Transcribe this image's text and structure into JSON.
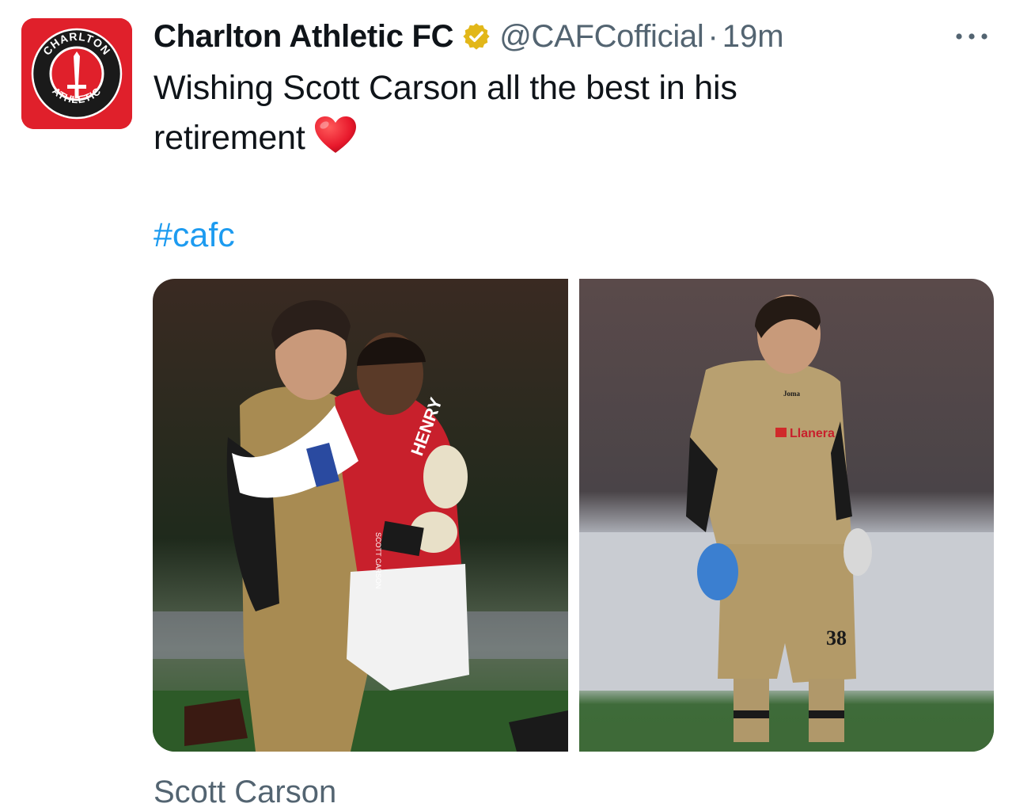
{
  "tweet": {
    "author_name": "Charlton Athletic FC",
    "handle": "@CAFCofficial",
    "separator": "·",
    "time": "19m",
    "text": "Wishing Scott Carson all the best in his retirement",
    "hashtag": "#cafc",
    "media_caption": "Scott Carson"
  },
  "avatar": {
    "logo_top_text": "CHARLTON",
    "logo_bottom_text": "ATHLETIC",
    "brand_color": "#e0202b"
  },
  "icons": {
    "verified": "verified-badge-icon",
    "more": "more-options-icon",
    "heart": "red-heart-emoji"
  },
  "photos": [
    {
      "description_name": "carson-henry-embrace-photo",
      "shirt_text": "HENRY",
      "glove_text": "SCOTT CARSON"
    },
    {
      "description_name": "carson-standing-photo",
      "sponsor_text": "Llanera",
      "shirt_number": "38",
      "kit_brand": "Joma"
    }
  ],
  "colors": {
    "text_primary": "#0f1419",
    "text_secondary": "#536471",
    "link": "#1d9bf0",
    "verified_gold": "#e2b719"
  }
}
